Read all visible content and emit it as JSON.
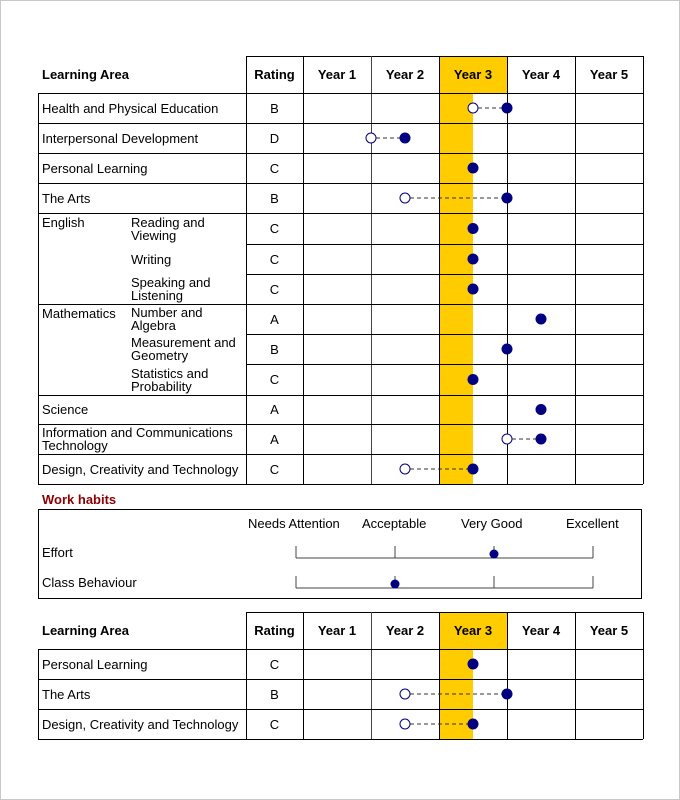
{
  "colors": {
    "highlight": "#ffcc00",
    "marker": "#000080",
    "section_title": "#8b0000",
    "grid": "#000000"
  },
  "table1": {
    "headers": {
      "learning_area": "Learning Area",
      "rating": "Rating",
      "years": [
        "Year 1",
        "Year 2",
        "Year 3",
        "Year 4",
        "Year 5"
      ],
      "current_year_index": 2
    },
    "rows": [
      {
        "group": "",
        "area": "Health and Physical Education",
        "rating": "B",
        "previous": 2.5,
        "current": 3.0
      },
      {
        "group": "",
        "area": "Interpersonal Development",
        "rating": "D",
        "previous": 1.0,
        "current": 1.5
      },
      {
        "group": "",
        "area": "Personal Learning",
        "rating": "C",
        "previous": null,
        "current": 2.5
      },
      {
        "group": "",
        "area": "The Arts",
        "rating": "B",
        "previous": 1.5,
        "current": 3.0
      },
      {
        "group": "English",
        "area": "Reading and Viewing",
        "rating": "C",
        "previous": null,
        "current": 2.5
      },
      {
        "group": "",
        "area": "Writing",
        "rating": "C",
        "previous": null,
        "current": 2.5
      },
      {
        "group": "",
        "area": "Speaking and Listening",
        "rating": "C",
        "previous": null,
        "current": 2.5
      },
      {
        "group": "Mathematics",
        "area": "Number and Algebra",
        "rating": "A",
        "previous": null,
        "current": 3.5
      },
      {
        "group": "",
        "area": "Measurement and Geometry",
        "rating": "B",
        "previous": null,
        "current": 3.0
      },
      {
        "group": "",
        "area": "Statistics and Probability",
        "rating": "C",
        "previous": null,
        "current": 2.5
      },
      {
        "group": "",
        "area": "Science",
        "rating": "A",
        "previous": null,
        "current": 3.5
      },
      {
        "group": "",
        "area": "Information and Communications Technology",
        "rating": "A",
        "previous": 3.0,
        "current": 3.5
      },
      {
        "group": "",
        "area": "Design, Creativity and Technology",
        "rating": "C",
        "previous": 1.5,
        "current": 2.5
      }
    ]
  },
  "work_habits": {
    "title": "Work habits",
    "scale": [
      "Needs Attention",
      "Acceptable",
      "Very Good",
      "Excellent"
    ],
    "items": [
      {
        "label": "Effort",
        "value_index": 2
      },
      {
        "label": "Class Behaviour",
        "value_index": 1
      }
    ]
  },
  "table2": {
    "headers": {
      "learning_area": "Learning Area",
      "rating": "Rating",
      "years": [
        "Year 1",
        "Year 2",
        "Year 3",
        "Year 4",
        "Year 5"
      ],
      "current_year_index": 2
    },
    "rows": [
      {
        "area": "Personal Learning",
        "rating": "C",
        "previous": null,
        "current": 2.5
      },
      {
        "area": "The Arts",
        "rating": "B",
        "previous": 1.5,
        "current": 3.0
      },
      {
        "area": "Design, Creativity and Technology",
        "rating": "C",
        "previous": 1.5,
        "current": 2.5
      }
    ]
  }
}
